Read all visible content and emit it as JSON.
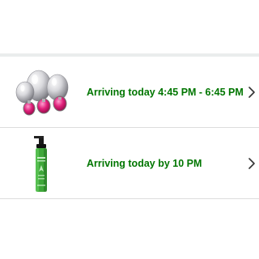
{
  "orders": [
    {
      "delivery_text": "Arriving today 4:45 PM - 6:45 PM",
      "thumbnail_icon": "metal-plug-set-product-image",
      "chevron_icon": "chevron-right-icon"
    },
    {
      "delivery_text": "Arriving today by 10 PM",
      "thumbnail_icon": "lubricant-pump-bottle-product-image",
      "chevron_icon": "chevron-right-icon"
    }
  ],
  "colors": {
    "delivery_green": "#007600",
    "divider": "#dddddd",
    "section_band": "#eaeded",
    "chevron": "#333333"
  }
}
